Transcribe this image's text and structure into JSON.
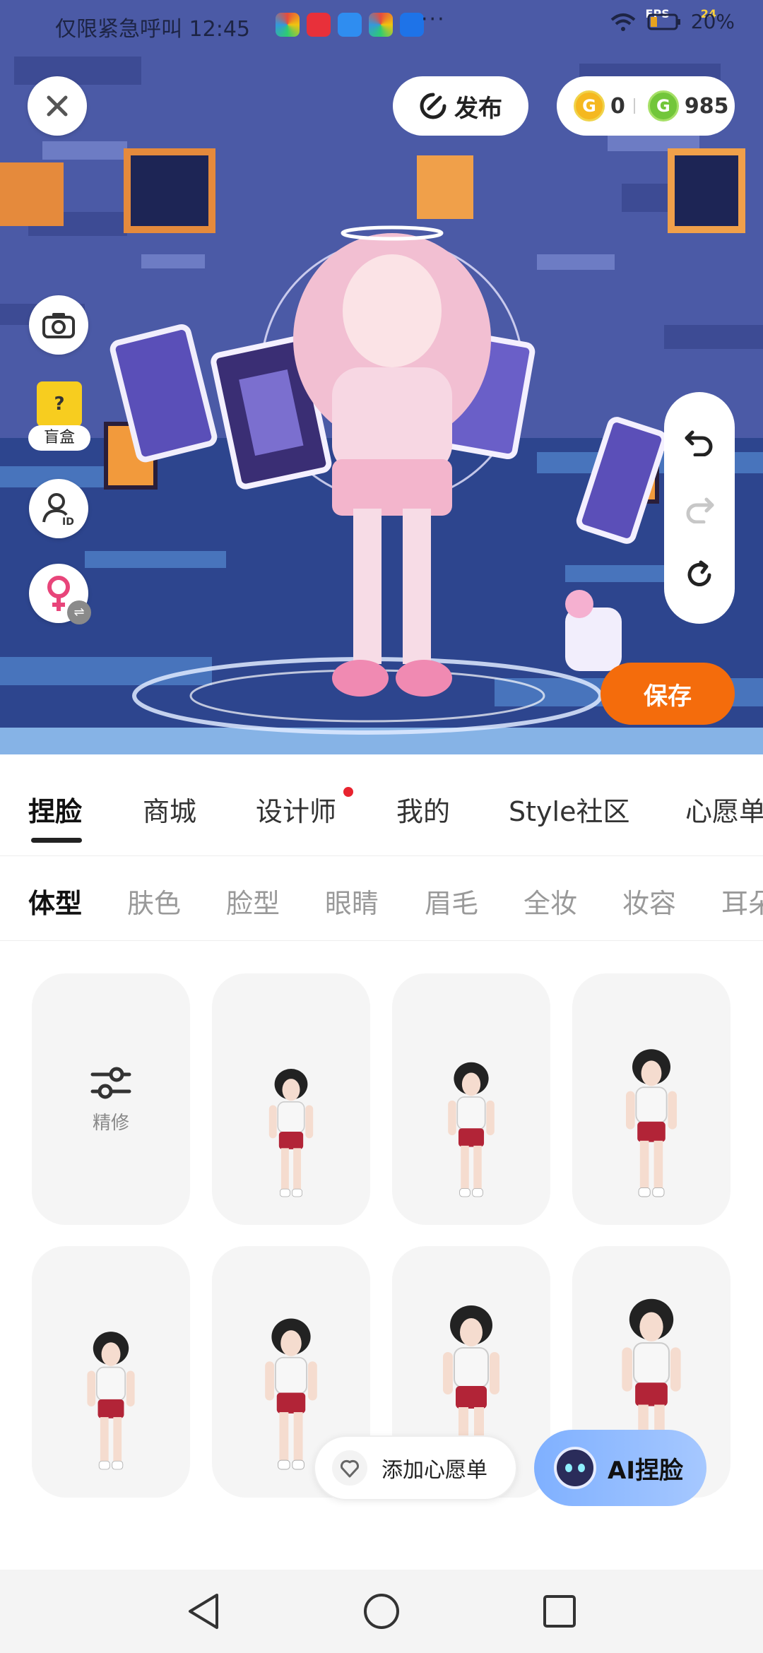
{
  "status_bar": {
    "carrier": "仅限紧急呼叫",
    "time": "12:45",
    "more": "···",
    "fps_label": "FPS",
    "fps_value": "24",
    "battery": "20%"
  },
  "top_bar": {
    "publish_label": "发布",
    "gold_coins": "0",
    "green_coins": "985"
  },
  "left_tools": {
    "blindbox_label": "盲盒"
  },
  "actions": {
    "save_label": "保存",
    "wishlist_label": "添加心愿单",
    "ai_label": "AI捏脸"
  },
  "main_tabs": [
    {
      "label": "捏脸",
      "active": true
    },
    {
      "label": "商城"
    },
    {
      "label": "设计师",
      "badge": "red-dot"
    },
    {
      "label": "我的"
    },
    {
      "label": "Style社区"
    },
    {
      "label": "心愿单"
    }
  ],
  "sub_tabs": [
    {
      "label": "体型",
      "active": true
    },
    {
      "label": "肤色"
    },
    {
      "label": "脸型"
    },
    {
      "label": "眼睛"
    },
    {
      "label": "眉毛"
    },
    {
      "label": "全妆"
    },
    {
      "label": "妆容"
    },
    {
      "label": "耳朵"
    }
  ],
  "grid": {
    "refine_label": "精修",
    "presets": [
      "body-preset-1",
      "body-preset-2",
      "body-preset-3",
      "body-preset-4",
      "body-preset-5",
      "body-preset-6",
      "body-preset-7"
    ]
  },
  "colors": {
    "accent_orange": "#f46c0c",
    "red_dot": "#e8232f",
    "gold_coin": "#f5b81f",
    "green_coin": "#72c63a"
  }
}
